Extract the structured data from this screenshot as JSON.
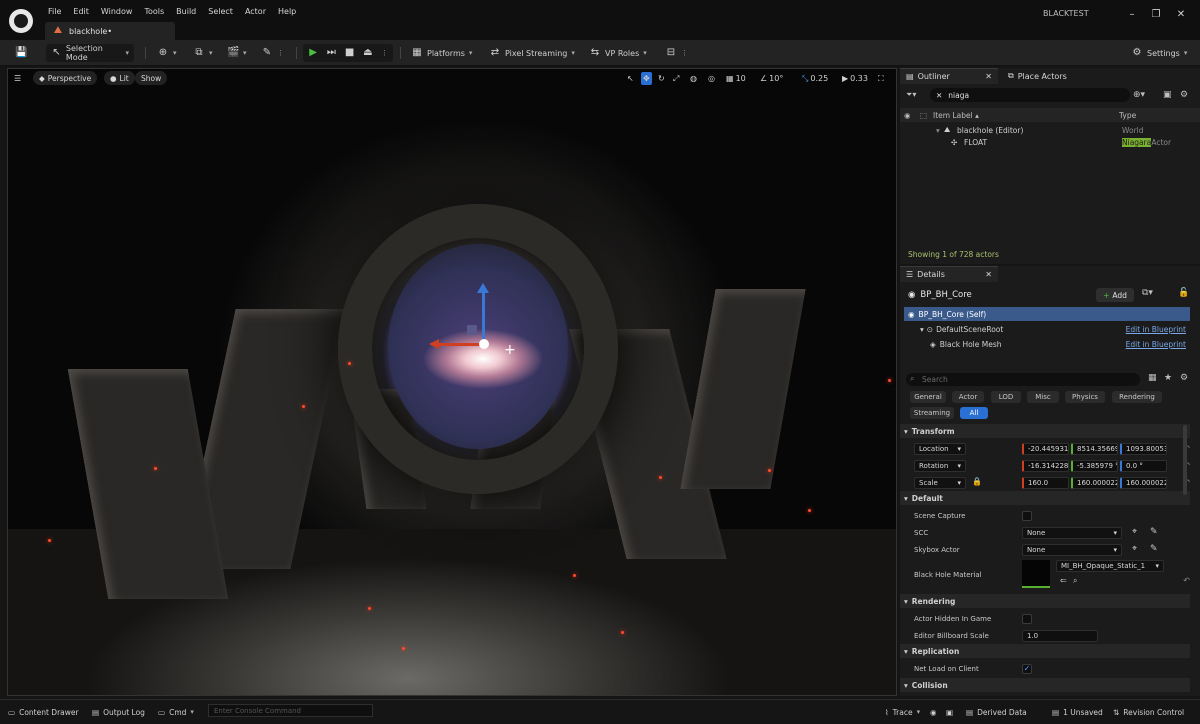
{
  "titlebar": {
    "menu": [
      "File",
      "Edit",
      "Window",
      "Tools",
      "Build",
      "Select",
      "Actor",
      "Help"
    ],
    "doc_tab": "blackhole•",
    "project": "BLACKTEST"
  },
  "toolbar": {
    "selection_mode": "Selection Mode",
    "platforms": "Platforms",
    "pixel_streaming": "Pixel Streaming",
    "vp_roles": "VP Roles",
    "settings": "Settings"
  },
  "viewport": {
    "perspective": "Perspective",
    "lit": "Lit",
    "show": "Show",
    "grid_snap": "10",
    "rot_snap": "10°",
    "scale_snap": "0.25",
    "cam_speed": "0.33"
  },
  "outliner": {
    "tab": "Outliner",
    "tab2": "Place Actors",
    "search": "niaga",
    "col_label": "Item Label ▴",
    "col_type": "Type",
    "rows": [
      {
        "label": "blackhole (Editor)",
        "type": "World"
      },
      {
        "label": "FLOAT",
        "type_highlight": "Niagara",
        "type_rest": "Actor"
      }
    ],
    "status": "Showing 1 of 728 actors"
  },
  "details": {
    "tab": "Details",
    "actor": "BP_BH_Core",
    "add": "Add",
    "self": "BP_BH_Core (Self)",
    "components": [
      {
        "name": "DefaultSceneRoot",
        "link": "Edit in Blueprint"
      },
      {
        "name": "Black Hole Mesh",
        "link": "Edit in Blueprint"
      }
    ],
    "search_placeholder": "Search",
    "categories": [
      "General",
      "Actor",
      "LOD",
      "Misc",
      "Physics",
      "Rendering",
      "Streaming",
      "All"
    ],
    "transform_title": "Transform",
    "location_label": "Location",
    "location": [
      "-20.445931",
      "8514.356697",
      "1093.800530"
    ],
    "rotation_label": "Rotation",
    "rotation": [
      "-16.314228",
      "-5.385979 °",
      "0.0 °"
    ],
    "scale_label": "Scale",
    "scale": [
      "160.0",
      "160.000022",
      "160.000022"
    ],
    "default_title": "Default",
    "scene_capture": "Scene Capture",
    "scc": "SCC",
    "scc_value": "None",
    "skybox": "Skybox Actor",
    "skybox_value": "None",
    "bh_material": "Black Hole Material",
    "bh_material_value": "MI_BH_Opaque_Static_1",
    "rendering_title": "Rendering",
    "hidden_in_game": "Actor Hidden In Game",
    "billboard_scale": "Editor Billboard Scale",
    "billboard_value": "1.0",
    "replication_title": "Replication",
    "net_load": "Net Load on Client",
    "collision_title": "Collision"
  },
  "statusbar": {
    "content_drawer": "Content Drawer",
    "output_log": "Output Log",
    "cmd": "Cmd",
    "console_placeholder": "Enter Console Command",
    "trace": "Trace",
    "derived_data": "Derived Data",
    "unsaved": "1 Unsaved",
    "revision": "Revision Control"
  }
}
